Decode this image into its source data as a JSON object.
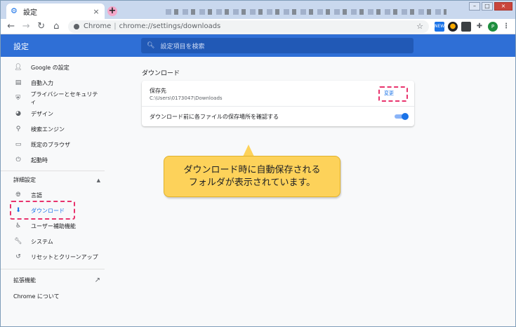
{
  "tab": {
    "title": "設定",
    "icon": "gear-icon"
  },
  "toolbar": {
    "omnibox_prefix": "Chrome",
    "omnibox_separator": "|",
    "omnibox_url": "chrome://settings/downloads",
    "extensions": [
      "new-badge-icon",
      "extension-dot-icon",
      "image-icon",
      "puzzle-icon",
      "profile-avatar-icon",
      "menu-icon"
    ],
    "avatar_letter": "P",
    "new_badge": "NEW"
  },
  "header": {
    "title": "設定",
    "search_placeholder": "設定項目を検索"
  },
  "sidebar": {
    "items": [
      {
        "label": "Google の設定",
        "icon": "person-icon"
      },
      {
        "label": "自動入力",
        "icon": "clipboard-icon"
      },
      {
        "label": "プライバシーとセキュリティ",
        "icon": "shield-icon"
      },
      {
        "label": "デザイン",
        "icon": "palette-icon"
      },
      {
        "label": "検索エンジン",
        "icon": "search-icon"
      },
      {
        "label": "既定のブラウザ",
        "icon": "browser-icon"
      },
      {
        "label": "起動時",
        "icon": "power-icon"
      }
    ],
    "advanced_label": "詳細設定",
    "advanced_items": [
      {
        "label": "言語",
        "icon": "globe-icon"
      },
      {
        "label": "ダウンロード",
        "icon": "download-icon",
        "active": true
      },
      {
        "label": "ユーザー補助機能",
        "icon": "accessibility-icon"
      },
      {
        "label": "システム",
        "icon": "wrench-icon"
      },
      {
        "label": "リセットとクリーンアップ",
        "icon": "restore-icon"
      }
    ],
    "extensions_label": "拡張機能",
    "about_label": "Chrome について"
  },
  "main": {
    "section_title": "ダウンロード",
    "location_label": "保存先",
    "location_path": "C:\\Users\\0173047\\Downloads",
    "change_button": "変更",
    "ask_where_label": "ダウンロード前に各ファイルの保存場所を確認する",
    "ask_where_enabled": true
  },
  "callout": {
    "line1": "ダウンロード時に自動保存される",
    "line2": "フォルダが表示されています。"
  },
  "colors": {
    "accent": "#1a73e8",
    "header": "#2f6fd6",
    "highlight_dashed": "#e8336d",
    "callout": "#fdd25a"
  }
}
